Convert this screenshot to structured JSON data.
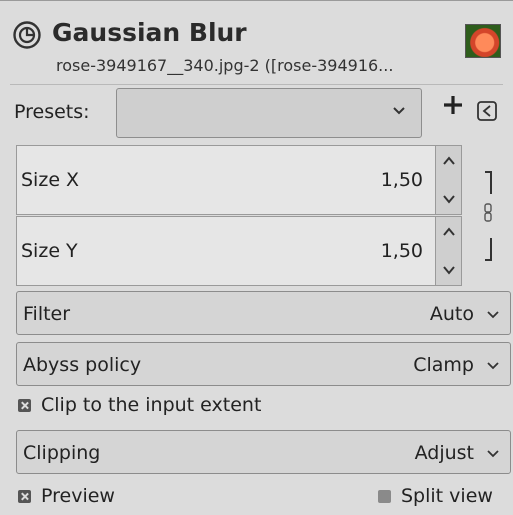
{
  "header": {
    "title": "Gaussian Blur",
    "subtitle": "rose-3949167__340.jpg-2 ([rose-394916..."
  },
  "presets": {
    "label": "Presets:",
    "value": ""
  },
  "size_x": {
    "label": "Size X",
    "value": "1,50"
  },
  "size_y": {
    "label": "Size Y",
    "value": "1,50"
  },
  "filter": {
    "label": "Filter",
    "value": "Auto"
  },
  "abyss": {
    "label": "Abyss policy",
    "value": "Clamp"
  },
  "clip_extent": {
    "label": "Clip to the input extent",
    "checked": true
  },
  "clipping": {
    "label": "Clipping",
    "value": "Adjust"
  },
  "preview": {
    "label": "Preview",
    "checked": true
  },
  "split_view": {
    "label": "Split view",
    "checked": false
  },
  "icons": [
    "gegl-icon",
    "chevron-down-icon",
    "plus-icon",
    "menu-icon",
    "chain-link-icon",
    "arrow-up-icon",
    "arrow-down-icon",
    "checkbox-icon"
  ]
}
